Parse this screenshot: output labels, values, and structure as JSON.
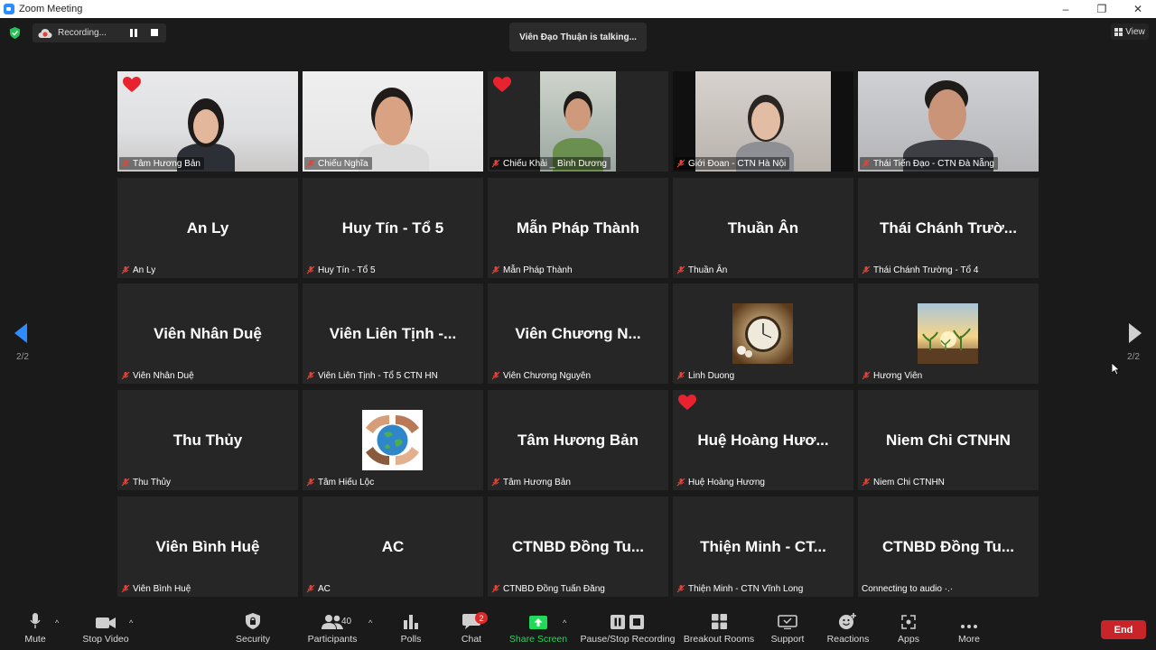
{
  "window": {
    "title": "Zoom Meeting",
    "controls": [
      "–",
      "❐",
      "✕"
    ]
  },
  "recording": {
    "label": "Recording..."
  },
  "active_speaker": {
    "text": "Viên Đạo Thuận is talking..."
  },
  "view_button": {
    "label": "View"
  },
  "pager": {
    "left": "2/2",
    "right": "2/2"
  },
  "tiles": [
    {
      "label": "Tâm Hương Bản",
      "video": true
    },
    {
      "label": "Chiếu Nghĩa",
      "video": true
    },
    {
      "label": "Chiếu Khải _ Bình Dương",
      "video": true
    },
    {
      "label": "Giới Đoan - CTN Hà Nội",
      "video": true
    },
    {
      "label": "Thái Tiến Đạo - CTN Đà Nẵng",
      "video": true
    },
    {
      "name": "An Ly",
      "label": "An Ly"
    },
    {
      "name": "Huy Tín - Tổ 5",
      "label": "Huy Tín - Tổ 5"
    },
    {
      "name": "Mẫn Pháp Thành",
      "label": "Mẫn Pháp Thành"
    },
    {
      "name": "Thuần Ân",
      "label": "Thuần Ân"
    },
    {
      "name": "Thái Chánh Trườ...",
      "label": "Thái Chánh Trường - Tổ 4"
    },
    {
      "name": "Viên Nhân Duệ",
      "label": "Viên Nhân Duệ"
    },
    {
      "name": "Viên Liên Tịnh -...",
      "label": "Viên Liên Tịnh - Tổ 5 CTN HN"
    },
    {
      "name": "Viên Chương N...",
      "label": "Viên Chương Nguyên"
    },
    {
      "label": "Linh Duong",
      "thumb": "pocket-watch-image"
    },
    {
      "label": "Hương Viên",
      "thumb": "sprouts-image"
    },
    {
      "name": "Thu Thủy",
      "label": "Thu Thủy"
    },
    {
      "label": "Tâm Hiếu Lộc",
      "thumb": "globe-hands-image"
    },
    {
      "name": "Tâm Hương Bản",
      "label": "Tâm Hương Bản"
    },
    {
      "name": "Huệ Hoàng Hươ...",
      "label": "Huệ Hoàng Hương"
    },
    {
      "name": "Niem Chi CTNHN",
      "label": "Niem Chi CTNHN"
    },
    {
      "name": "Viên Bình Huệ",
      "label": "Viên Bình Huệ"
    },
    {
      "name": "AC",
      "label": "AC"
    },
    {
      "name": "CTNBD Đồng Tu...",
      "label": "CTNBD Đồng Tuấn Đăng"
    },
    {
      "name": "Thiện Minh - CT...",
      "label": "Thiện Minh - CTN Vĩnh Long"
    },
    {
      "name": "CTNBD Đồng Tu...",
      "label": "Connecting to audio ·.·",
      "connecting": true
    }
  ],
  "toolbar": {
    "mute": "Mute",
    "stop_video": "Stop Video",
    "security": "Security",
    "participants": "Participants",
    "participants_count": "40",
    "polls": "Polls",
    "chat": "Chat",
    "chat_badge": "2",
    "share_screen": "Share Screen",
    "pause_stop_recording": "Pause/Stop Recording",
    "breakout_rooms": "Breakout Rooms",
    "support": "Support",
    "reactions": "Reactions",
    "apps": "Apps",
    "more": "More",
    "end": "End"
  },
  "colors": {
    "accent": "#2d8cff",
    "share_green": "#23d959",
    "end_red": "#c8242a",
    "mic_muted_red": "#e0453a",
    "heart": "#e8222e"
  }
}
